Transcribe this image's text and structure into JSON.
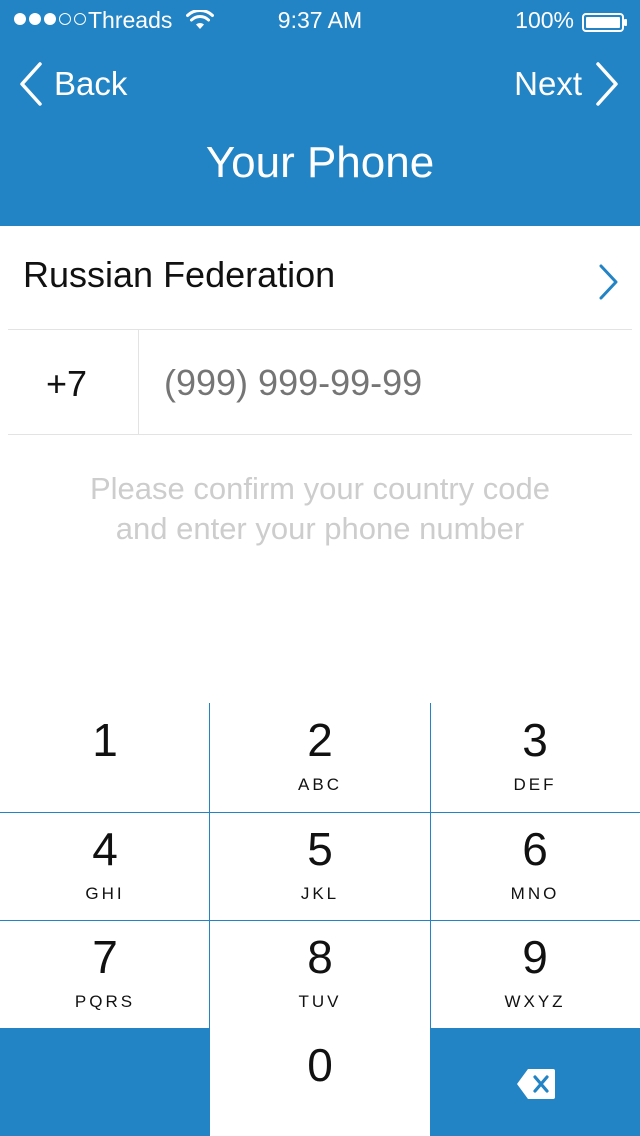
{
  "status_bar": {
    "carrier": "Threads",
    "time": "9:37 AM",
    "battery": "100%",
    "signal_bars_filled": 3,
    "signal_bars_total": 5
  },
  "nav": {
    "back_label": "Back",
    "next_label": "Next"
  },
  "title": "Your Phone",
  "country": {
    "name": "Russian Federation"
  },
  "phone": {
    "code": "+7",
    "placeholder": "(999) 999-99-99"
  },
  "hint": {
    "line1": "Please confirm your country code",
    "line2": "and enter your phone number"
  },
  "keypad": {
    "keys": [
      {
        "digit": "1",
        "letters": ""
      },
      {
        "digit": "2",
        "letters": "ABC"
      },
      {
        "digit": "3",
        "letters": "DEF"
      },
      {
        "digit": "4",
        "letters": "GHI"
      },
      {
        "digit": "5",
        "letters": "JKL"
      },
      {
        "digit": "6",
        "letters": "MNO"
      },
      {
        "digit": "7",
        "letters": "PQRS"
      },
      {
        "digit": "8",
        "letters": "TUV"
      },
      {
        "digit": "9",
        "letters": "WXYZ"
      },
      {
        "digit": "0",
        "letters": ""
      }
    ]
  },
  "colors": {
    "accent": "#2284c5",
    "hint_text": "#cdcdcd",
    "separator": "#e3e3e3"
  }
}
